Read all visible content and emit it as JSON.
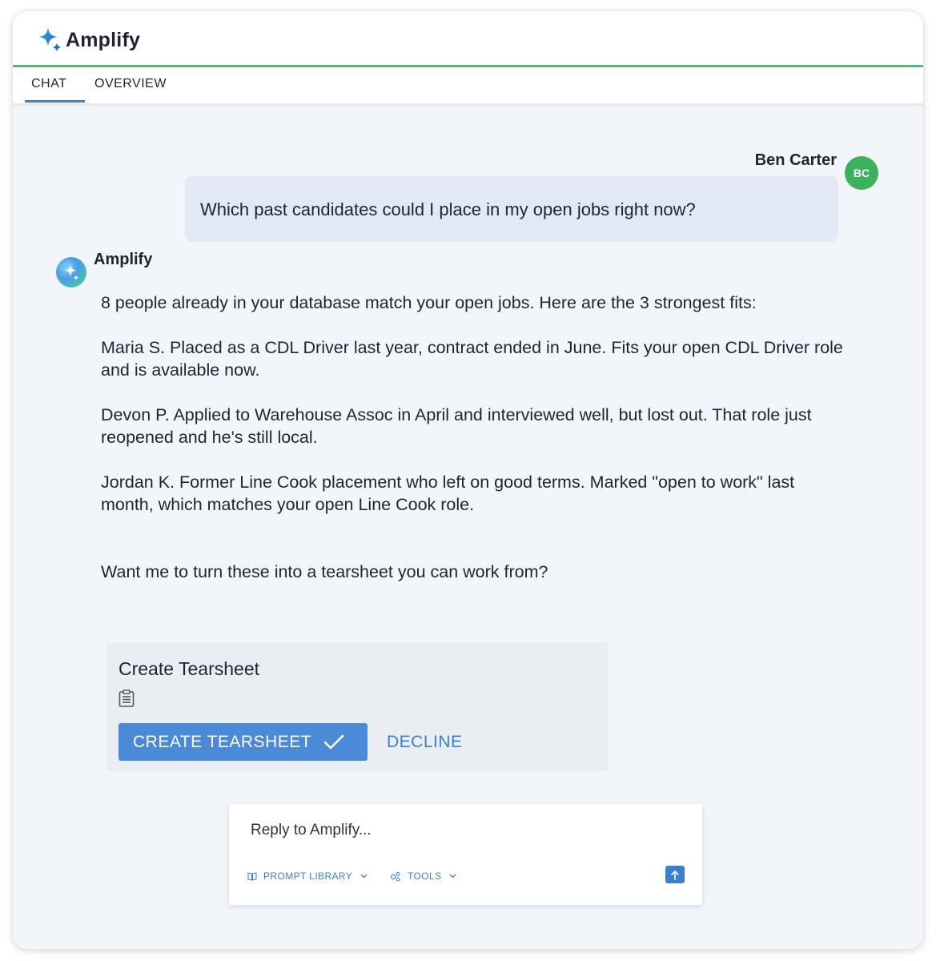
{
  "app": {
    "name": "Amplify"
  },
  "tabs": [
    {
      "label": "CHAT"
    },
    {
      "label": "OVERVIEW"
    }
  ],
  "user": {
    "name": "Ben Carter",
    "initials": "BC",
    "avatar_color": "#3bb35c",
    "message": "Which past candidates could I place in my open jobs right now?"
  },
  "assistant": {
    "name": "Amplify",
    "paragraphs": [
      "8 people already in your database match your open jobs. Here are the 3 strongest fits:",
      "Maria S. Placed as a CDL Driver last year, contract ended in June. Fits your open CDL Driver role and is available now.",
      "Devon P. Applied to Warehouse Assoc in April and interviewed well, but lost out. That role just reopened and he's still local.",
      "Jordan K. Former Line Cook placement who left on good terms. Marked \"open to work\" last month, which matches your open Line Cook role."
    ],
    "closing": "Want me to turn these into a tearsheet you can work from?"
  },
  "action_card": {
    "title": "Create Tearsheet",
    "icon": "clipboard-icon",
    "confirm_label": "CREATE TEARSHEET",
    "decline_label": "DECLINE"
  },
  "composer": {
    "placeholder": "Reply to Amplify...",
    "prompt_library_label": "PROMPT LIBRARY",
    "tools_label": "TOOLS"
  },
  "colors": {
    "accent": "#3b7fcf",
    "header_border": "#5cb87a",
    "button": "#4a8ad6"
  }
}
